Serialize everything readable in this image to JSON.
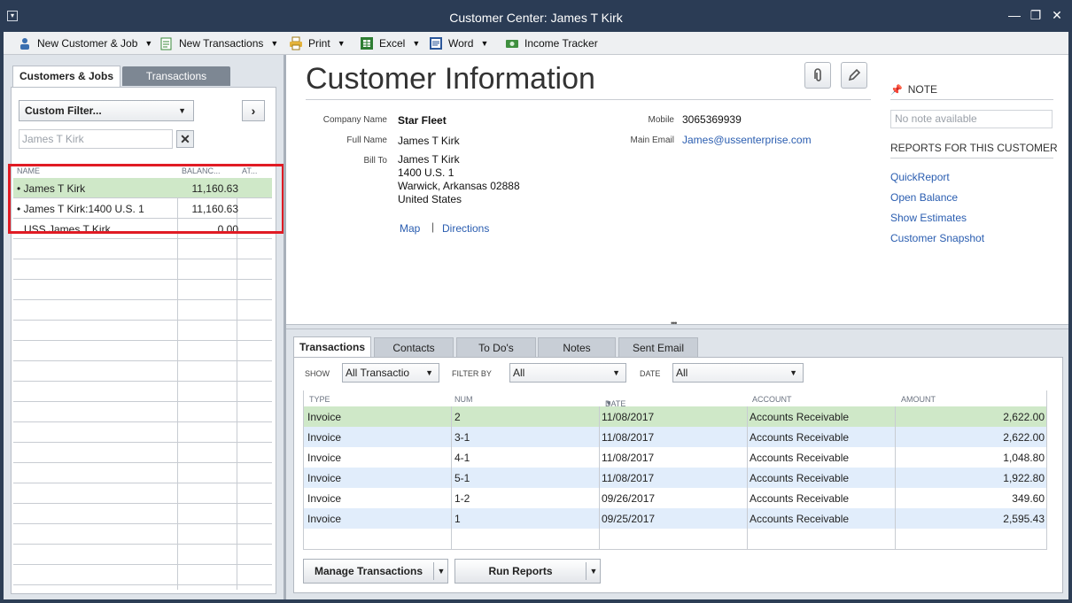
{
  "window": {
    "title": "Customer Center: James T Kirk"
  },
  "toolbar": {
    "new_customer": "New Customer & Job",
    "new_transactions": "New Transactions",
    "print": "Print",
    "excel": "Excel",
    "word": "Word",
    "income_tracker": "Income Tracker"
  },
  "left": {
    "tab_customers": "Customers & Jobs",
    "tab_transactions": "Transactions",
    "filter": "Custom Filter...",
    "search_value": "James T Kirk",
    "columns": [
      "NAME",
      "BALANC...",
      "AT..."
    ],
    "rows": [
      {
        "name": "James T Kirk",
        "balance": "11,160.63",
        "prefix": "•"
      },
      {
        "name": "James T Kirk:1400 U.S. 1",
        "balance": "11,160.63",
        "prefix": "•"
      },
      {
        "name": "USS James T Kirk",
        "balance": "0.00",
        "prefix": ""
      }
    ]
  },
  "info": {
    "title": "Customer Information",
    "company_label": "Company Name",
    "company": "Star Fleet",
    "fullname_label": "Full Name",
    "fullname": "James T  Kirk",
    "billto_label": "Bill To",
    "bill_lines": [
      "James T Kirk",
      "1400 U.S. 1",
      "Warwick, Arkansas 02888",
      "United States"
    ],
    "map": "Map",
    "sep": "|",
    "directions": "Directions",
    "mobile_label": "Mobile",
    "mobile": "3065369939",
    "email_label": "Main Email",
    "email": "James@ussenterprise.com"
  },
  "note": {
    "header": "NOTE",
    "empty": "No note available",
    "reports_header": "REPORTS FOR THIS CUSTOMER",
    "reports": [
      "QuickReport",
      "Open Balance",
      "Show Estimates",
      "Customer Snapshot"
    ]
  },
  "bottom": {
    "tabs": [
      "Transactions",
      "Contacts",
      "To Do's",
      "Notes",
      "Sent Email"
    ],
    "show_label": "SHOW",
    "show_value": "All Transactio",
    "filter_label": "FILTER BY",
    "filter_value": "All",
    "date_label": "DATE",
    "date_value": "All",
    "columns": [
      "TYPE",
      "NUM",
      "DATE",
      "ACCOUNT",
      "AMOUNT"
    ],
    "rows": [
      {
        "type": "Invoice",
        "num": "2",
        "date": "11/08/2017",
        "account": "Accounts Receivable",
        "amount": "2,622.00"
      },
      {
        "type": "Invoice",
        "num": "3-1",
        "date": "11/08/2017",
        "account": "Accounts Receivable",
        "amount": "2,622.00"
      },
      {
        "type": "Invoice",
        "num": "4-1",
        "date": "11/08/2017",
        "account": "Accounts Receivable",
        "amount": "1,048.80"
      },
      {
        "type": "Invoice",
        "num": "5-1",
        "date": "11/08/2017",
        "account": "Accounts Receivable",
        "amount": "1,922.80"
      },
      {
        "type": "Invoice",
        "num": "1-2",
        "date": "09/26/2017",
        "account": "Accounts Receivable",
        "amount": "349.60"
      },
      {
        "type": "Invoice",
        "num": "1",
        "date": "09/25/2017",
        "account": "Accounts Receivable",
        "amount": "2,595.43"
      }
    ],
    "manage": "Manage Transactions",
    "run_reports": "Run Reports"
  },
  "colors": {
    "titlebar": "#2b3c55",
    "selected_row": "#cfe8c8",
    "alt_row": "#e1edfb",
    "link": "#2a5db0",
    "highlight": "#e01b24"
  }
}
